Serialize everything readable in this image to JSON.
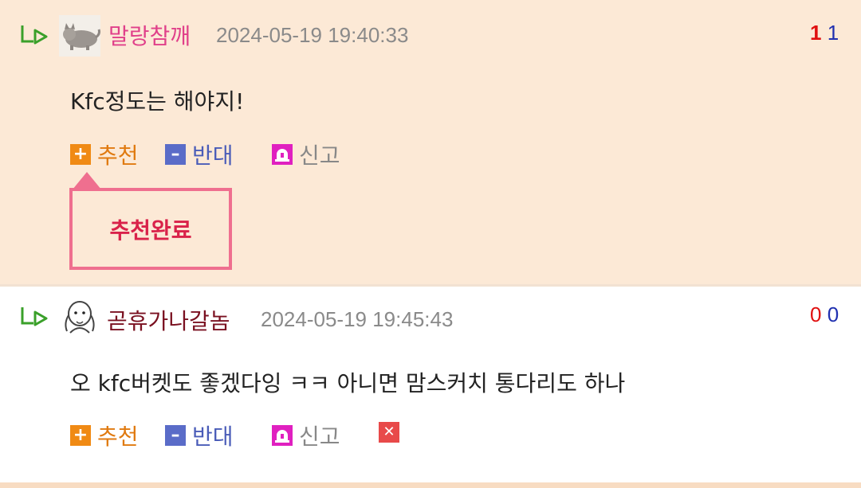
{
  "comments": [
    {
      "nickname": "말랑참깨",
      "nickname_color": "#e0408a",
      "date": "2024-05-19 19:40:33",
      "votes_up": "1",
      "votes_down": "1",
      "body": "Kfc정도는 해야지!",
      "actions": {
        "recommend": "추천",
        "oppose": "반대",
        "report": "신고"
      },
      "tooltip": "추천완료",
      "avatar": "cat-avatar-icon"
    },
    {
      "nickname": "곧휴가나갈놈",
      "nickname_color": "#7a1020",
      "date": "2024-05-19 19:45:43",
      "votes_up": "0",
      "votes_down": "0",
      "body": "오 kfc버켓도 좋겠다잉 ㅋㅋ 아니면 맘스커치 통다리도 하나",
      "actions": {
        "recommend": "추천",
        "oppose": "반대",
        "report": "신고",
        "delete": "✕"
      },
      "avatar": "sketch-avatar-icon"
    }
  ],
  "colors": {
    "highlight_bg": "#fce9d6",
    "reply_icon": "#3aa02a",
    "recommend": "#f08a14",
    "oppose": "#5a6cc8",
    "report": "#e020c0",
    "delete": "#e84a4a",
    "tooltip_border": "#ef6f8f",
    "tooltip_text": "#d9224a"
  }
}
